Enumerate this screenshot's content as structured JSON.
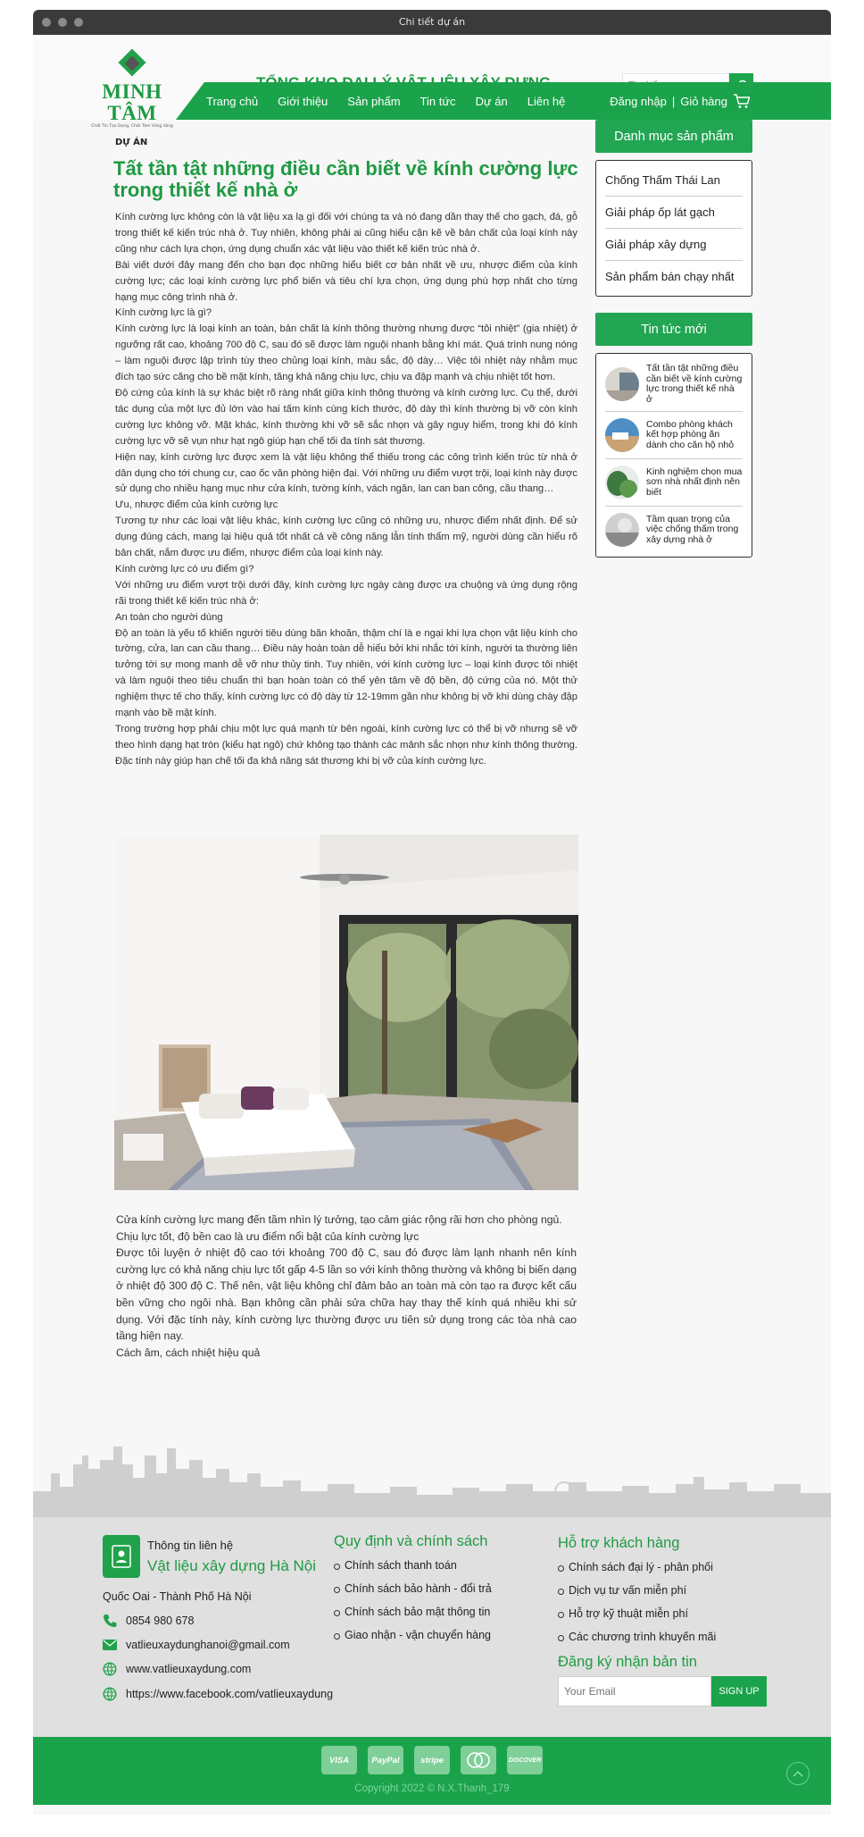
{
  "window": {
    "title": "Chi tiết dự án"
  },
  "header": {
    "logo_name": "MINH TÂM",
    "logo_tagline": "Chất Tín Tạo Dựng, Chất Tâm Vững Vàng",
    "brand_title": "TỔNG KHO ĐẠI LÝ VẬT LIỆU XÂY DỰNG",
    "search_placeholder": "Tìm kiếm ..."
  },
  "nav": {
    "items": [
      "Trang chủ",
      "Giới thiệu",
      "Sản phẩm",
      "Tin tức",
      "Dự án",
      "Liên hệ"
    ],
    "login": "Đăng nhập",
    "separator": "|",
    "cart": "Giỏ hàng"
  },
  "article": {
    "breadcrumb": "DỰ ÁN",
    "title": "Tất tần tật những điều cần biết về kính cường lực trong thiết kế nhà ở",
    "paragraphs": [
      "Kính cường lực không còn là vật liệu xa lạ gì đối với chúng ta và nó đang dần thay thế cho gạch, đá, gỗ trong thiết kế kiến trúc nhà ở. Tuy nhiên, không phải ai cũng hiểu cặn kẽ về bản chất của loại kính này cũng như cách lựa chọn, ứng dụng chuẩn xác vật liệu vào thiết kế kiến trúc nhà ở.",
      "Bài viết dưới đây mang đến cho bạn đọc những hiểu biết cơ bản nhất về ưu, nhược điểm của kính cường lực; các loại kính cường lực phổ biến và tiêu chí lựa chọn, ứng dụng phù hợp nhất cho từng hạng mục công trình nhà ở.",
      "Kính cường lực là gì?",
      "Kính cường lực là loại kính an toàn, bản chất là kính thông thường nhưng được “tôi nhiệt” (gia nhiệt) ở ngưỡng rất cao, khoảng 700 độ C, sau đó sẽ được làm nguội nhanh bằng khí mát. Quá trình nung nóng – làm nguội được lập trình tùy theo chủng loại kính, màu sắc, độ dày… Việc tôi nhiệt này nhằm mục đích tạo sức căng cho bề mặt kính, tăng khả năng chịu lực, chịu va đập mạnh và chịu nhiệt tốt hơn.",
      "Độ cứng của kính là sự khác biệt rõ ràng nhất giữa kính thông thường và kính cường lực. Cụ thể, dưới tác dụng của một lực đủ lớn vào hai tấm kính cùng kích thước, độ dày thì kính thường bị vỡ còn kính cường lực không vỡ. Mặt khác, kính thường khi vỡ sẽ sắc nhọn và gây nguy hiểm, trong khi đó kính cường lực vỡ sẽ vụn như hạt ngô giúp hạn chế tối đa tính sát thương.",
      "Hiện nay, kính cường lực được xem là vật liệu không thể thiếu trong các công trình kiến trúc từ nhà ở dân dụng cho tới chung cư, cao ốc văn phòng hiện đại. Với những ưu điểm vượt trội, loại kính này được sử dụng cho nhiều hạng mục như cửa kính, tường kính, vách ngăn, lan can ban công, cầu thang…",
      " Ưu, nhược điểm của kính cường lực",
      "Tương tự như các loại vật liệu khác, kính cường lực cũng có những ưu, nhược điểm nhất định. Để sử dụng đúng cách, mang lại hiệu quả tốt nhất cả về công năng lẫn tính thẩm mỹ, người dùng cần hiểu rõ bản chất, nắm được ưu điểm, nhược điểm của loại kính này.",
      " Kính cường lực có ưu điểm gì?",
      "Với những ưu điểm vượt trội dưới đây, kính cường lực ngày càng được ưa chuộng và ứng dụng rộng rãi trong thiết kế kiến trúc nhà ở:",
      " An toàn cho người dùng",
      "Độ an toàn là yếu tố khiến người tiêu dùng băn khoăn, thậm chí là e ngại khi lựa chọn vật liệu kính cho tường, cửa, lan can cầu thang… Điều này hoàn toàn dễ hiểu bởi khi nhắc tới kính, người ta thường liên tưởng tới sự mong manh dễ vỡ như thủy tinh. Tuy nhiên, với kính cường lực – loại kính được tôi nhiệt và làm nguội theo tiêu chuẩn thì bạn hoàn toàn có thể yên tâm về độ bền, độ cứng của nó. Một thử nghiệm thực tế cho thấy, kính cường lực có độ dày từ 12-19mm gần như không bị vỡ khi dùng chày đập mạnh vào bề mặt kính.",
      "Trong trường hợp phải chịu một lực quá mạnh từ bên ngoài, kính cường lực có thể bị vỡ nhưng sẽ vỡ theo hình dạng hạt tròn (kiểu hạt ngô) chứ không tạo thành các mảnh sắc nhọn như kính thông thường. Đặc tính này giúp hạn chế tối đa khả năng sát thương khi bị vỡ của kính cường lực."
    ],
    "paragraphs2": [
      "Cửa kính cường lực mang đến tầm nhìn lý tưởng, tạo cảm giác rộng rãi hơn cho phòng ngủ.",
      "Chịu lực tốt, độ bền cao là ưu điểm nổi bật của kính cường lực",
      "Được tôi luyện ở nhiệt độ cao tới khoảng 700 độ C, sau đó được làm lạnh nhanh nên kính cường lực có khả năng chịu lực tốt gấp 4-5 lần so với kính thông thường và không bị biến dạng ở nhiệt độ 300 độ C. Thế nên, vật liệu không chỉ đảm bảo an toàn mà còn tạo ra được kết cấu bền vững cho ngôi nhà. Bạn không cần phải sửa chữa hay thay thế kính quá nhiều khi sử dụng. Với đặc tính này, kính cường lực thường được ưu tiên sử dụng trong các tòa nhà cao tầng hiện nay.",
      "Cách âm, cách nhiệt hiệu quả"
    ]
  },
  "sidebar": {
    "categories_title": "Danh mục sản phẩm",
    "categories": [
      "Chống Thấm Thái Lan",
      "Giải pháp ốp lát gạch",
      "Giải pháp xây dựng",
      "Sản phẩm bán chạy nhất"
    ],
    "news_title": "Tin tức mới",
    "news": [
      "Tất tần tật những điều cần biết về kính cường lực trong thiết kế nhà ở",
      "Combo phòng khách kết hợp phòng ăn dành cho căn hộ nhỏ",
      "Kinh nghiệm chọn mua sơn nhà nhất định nên biết",
      "Tầm quan trọng của việc chống thấm trong xây dựng nhà ở"
    ]
  },
  "footer": {
    "contact_label": "Thông tin liên hệ",
    "store_name": "Vật liệu xây dựng Hà Nội",
    "address": "Quốc Oai - Thành Phố Hà Nội",
    "phone": "0854 980 678",
    "email": "vatlieuxaydunghanoi@gmail.com",
    "website": "www.vatlieuxaydung.com",
    "facebook": "https://www.facebook.com/vatlieuxaydung",
    "policy_title": "Quy định và chính sách",
    "policies": [
      "Chính sách thanh toán",
      "Chính sách bảo hành - đổi trả",
      "Chính sách bảo mật thông tin",
      "Giao nhận - vận chuyển hàng"
    ],
    "support_title": "Hỗ trợ khách hàng",
    "supports": [
      "Chính sách đại lý - phân phối",
      "Dịch vụ tư vấn miễn phí",
      "Hỗ trợ kỹ thuật miễn phí",
      "Các chương trình khuyến mãi"
    ],
    "subscribe_title": "Đăng ký nhận bản tin",
    "email_placeholder": "Your Email",
    "signup": "SIGN UP",
    "payments": [
      "VISA",
      "PayPal",
      "stripe",
      "MC",
      "DISCOVER"
    ],
    "copyright": "Copyright 2022 © N.X.Thanh_179"
  },
  "colors": {
    "brand_green": "#1aa34a",
    "title_green": "#1f9a43",
    "titlebar": "#3a3a3a"
  }
}
